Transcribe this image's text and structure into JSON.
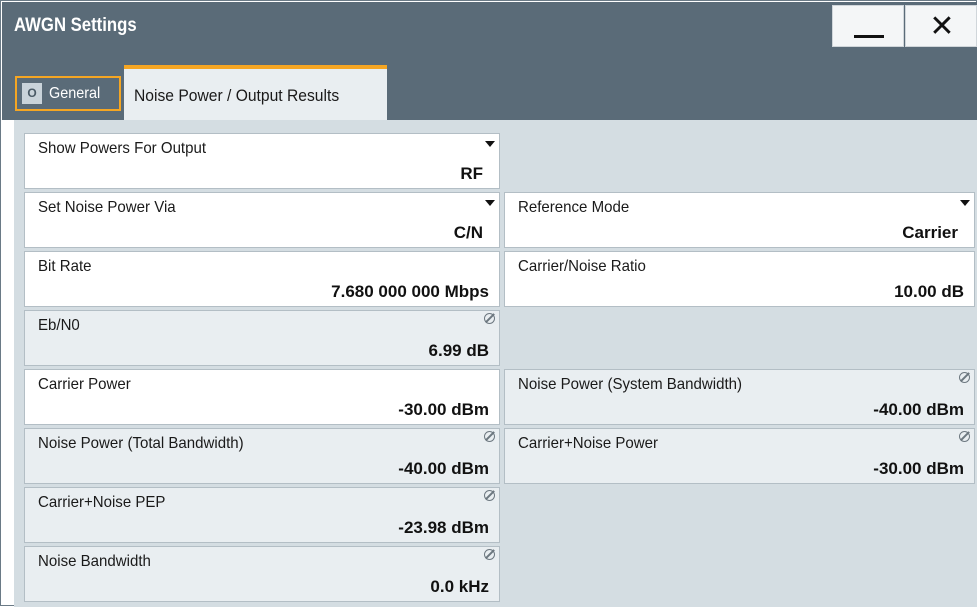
{
  "window": {
    "title": "AWGN Settings",
    "minimize_icon": "minimize-icon",
    "close_glyph": "✕"
  },
  "tabs": {
    "general": {
      "label": "General",
      "icon": "power-icon",
      "icon_glyph": "O"
    },
    "noise_power": {
      "label": "Noise Power / Output Results"
    }
  },
  "fields": {
    "show_powers_for_output": {
      "label": "Show Powers For Output",
      "value": "RF"
    },
    "set_noise_power_via": {
      "label": "Set Noise Power Via",
      "value": "C/N"
    },
    "reference_mode": {
      "label": "Reference Mode",
      "value": "Carrier"
    },
    "bit_rate": {
      "label": "Bit Rate",
      "value": "7.680 000 000 Mbps"
    },
    "carrier_noise_ratio": {
      "label": "Carrier/Noise Ratio",
      "value": "10.00 dB"
    },
    "eb_n0": {
      "label": "Eb/N0",
      "value": "6.99 dB"
    },
    "carrier_power": {
      "label": "Carrier Power",
      "value": "-30.00 dBm"
    },
    "noise_power_system_bw": {
      "label": "Noise Power (System Bandwidth)",
      "value": "-40.00 dBm"
    },
    "noise_power_total_bw": {
      "label": "Noise Power (Total Bandwidth)",
      "value": "-40.00 dBm"
    },
    "carrier_noise_power": {
      "label": "Carrier+Noise Power",
      "value": "-30.00 dBm"
    },
    "carrier_noise_pep": {
      "label": "Carrier+Noise PEP",
      "value": "-23.98 dBm"
    },
    "noise_bandwidth": {
      "label": "Noise Bandwidth",
      "value": "0.0 kHz"
    }
  },
  "colors": {
    "titlebar": "#5a6b78",
    "accent": "#f5a623",
    "content_bg": "#d4dde2",
    "readonly_field": "#e9eef1"
  }
}
